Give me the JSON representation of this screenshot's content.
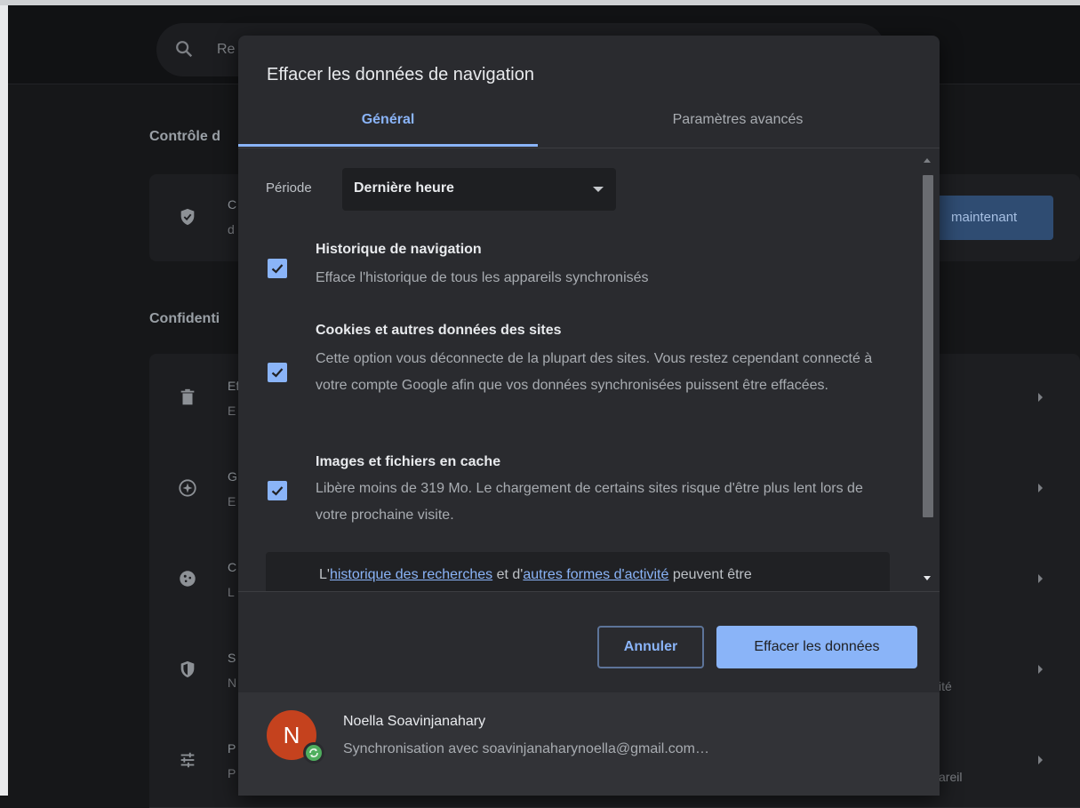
{
  "background": {
    "search_placeholder": "Re",
    "section1_title": "Contrôle d",
    "card1": {
      "line1": "C",
      "line2": "d",
      "button_label": "maintenant"
    },
    "section2_title": "Confidenti",
    "rows": [
      {
        "icon": "trash-icon",
        "line1": "Ef",
        "line2": "E",
        "tail": ""
      },
      {
        "icon": "compass-icon",
        "line1": "G",
        "line2": "E",
        "tail": ""
      },
      {
        "icon": "cookie-icon",
        "line1": "C",
        "line2": "L",
        "tail": ""
      },
      {
        "icon": "shield-icon",
        "line1": "S",
        "line2": "N",
        "tail": "ité"
      },
      {
        "icon": "sliders-icon",
        "line1": "P",
        "line2": "P",
        "tail": "areil"
      }
    ]
  },
  "dialog": {
    "title": "Effacer les données de navigation",
    "tabs": {
      "general": "Général",
      "advanced": "Paramètres avancés"
    },
    "period": {
      "label": "Période",
      "value": "Dernière heure"
    },
    "items": [
      {
        "title": "Historique de navigation",
        "description": "Efface l'historique de tous les appareils synchronisés",
        "checked": true
      },
      {
        "title": "Cookies et autres données des sites",
        "description": "Cette option vous déconnecte de la plupart des sites. Vous restez cependant connecté à votre compte Google afin que vos données synchronisées puissent être effacées.",
        "checked": true
      },
      {
        "title": "Images et fichiers en cache",
        "description": "Libère moins de 319 Mo. Le chargement de certains sites risque d'être plus lent lors de votre prochaine visite.",
        "checked": true
      }
    ],
    "info": {
      "prefix": "L'",
      "link1": "historique des recherches",
      "middle": " et d'",
      "link2": "autres formes d'activité",
      "suffix": " peuvent être"
    },
    "buttons": {
      "cancel": "Annuler",
      "clear": "Effacer les données"
    },
    "account": {
      "initial": "N",
      "name": "Noella Soavinjanahary",
      "sync_text": "Synchronisation avec soavinjanaharynoella@gmail.com…"
    }
  },
  "colors": {
    "accent": "#8ab4f8",
    "dialog_bg": "#2a2b2f",
    "avatar": "#c5421e",
    "sync_badge": "#4fae5e"
  }
}
